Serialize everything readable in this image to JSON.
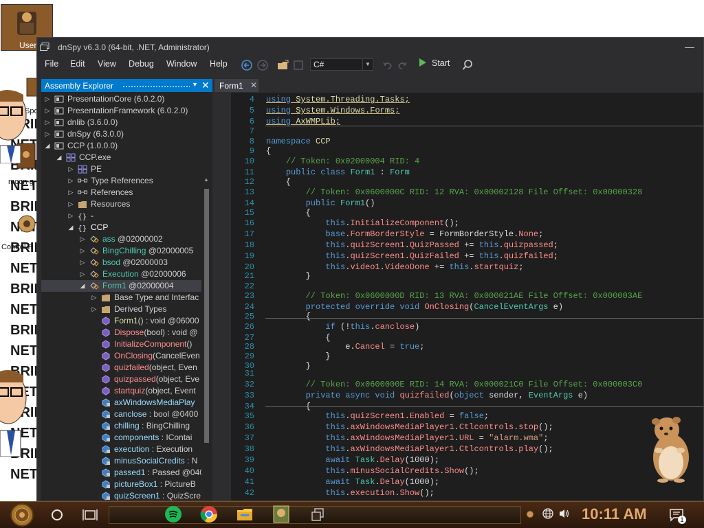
{
  "desktop": {
    "icons": [
      {
        "label": "User"
      },
      {
        "label": "Spo"
      },
      {
        "label": "moon g"
      },
      {
        "label": "Control P"
      }
    ],
    "wallpaper_words": [
      "BRII",
      "NET",
      "BRII",
      "NET",
      "BRII",
      "NET",
      "BRII",
      "NET",
      "BRII",
      "NET",
      "BRII",
      "NET",
      "BRII",
      "NET",
      "BRII",
      "NET",
      "BRII",
      "NET"
    ]
  },
  "window": {
    "title": "dnSpy v6.3.0 (64-bit, .NET, Administrator)",
    "menu": [
      "File",
      "Edit",
      "View",
      "Debug",
      "Window",
      "Help"
    ],
    "toolbar": {
      "language": "C#",
      "start_label": "Start"
    }
  },
  "explorer": {
    "title": "Assembly Explorer",
    "rows": [
      {
        "text": "PresentationCore (6.0.2.0)"
      },
      {
        "text": "PresentationFramework (6.0.2.0)"
      },
      {
        "text": "dnlib (3.6.0.0)"
      },
      {
        "text": "dnSpy (6.3.0.0)"
      },
      {
        "text": "CCP (1.0.0.0)"
      },
      {
        "text": "CCP.exe"
      },
      {
        "text": "PE"
      },
      {
        "text": "Type References"
      },
      {
        "text": "References"
      },
      {
        "text": "Resources"
      },
      {
        "text": "-"
      },
      {
        "text": "CCP"
      },
      {
        "name": "ass",
        "rest": " @02000002"
      },
      {
        "name": "BingChilling",
        "rest": " @02000005"
      },
      {
        "name": "bsod",
        "rest": " @02000003"
      },
      {
        "name": "Execution",
        "rest": " @02000006"
      },
      {
        "name": "Form1",
        "rest": " @02000004"
      },
      {
        "text": "Base Type and Interfac"
      },
      {
        "text": "Derived Types"
      },
      {
        "name": "Form1",
        "rest": "() : void @06000"
      },
      {
        "name": "Dispose",
        "rest": "(bool) : void @"
      },
      {
        "name": "InitializeComponent",
        "rest": "()"
      },
      {
        "name": "OnClosing",
        "rest": "(CancelEven"
      },
      {
        "name": "quizfailed",
        "rest": "(object, Even"
      },
      {
        "name": "quizpassed",
        "rest": "(object, Eve"
      },
      {
        "name": "startquiz",
        "rest": "(object, Event"
      },
      {
        "name": "axWindowsMediaPlay",
        "rest": ""
      },
      {
        "name": "canclose",
        "rest": " : bool @0400"
      },
      {
        "name": "chilling",
        "rest": " : BingChilling"
      },
      {
        "name": "components",
        "rest": " : IContai"
      },
      {
        "name": "execution",
        "rest": " : Execution"
      },
      {
        "name": "minusSocialCredits",
        "rest": " : N"
      },
      {
        "name": "passed1",
        "rest": " : Passed @040"
      },
      {
        "name": "pictureBox1",
        "rest": " : PictureB"
      },
      {
        "name": "quizScreen1",
        "rest": " : QuizScre"
      }
    ]
  },
  "editor": {
    "tab": "Form1",
    "lines": [
      {
        "n": "4",
        "seg": [
          [
            "k",
            "using "
          ],
          [
            "ns",
            "System.Threading.Tasks"
          ],
          [
            "p",
            ";"
          ]
        ]
      },
      {
        "n": "5",
        "seg": [
          [
            "k",
            "using "
          ],
          [
            "ns",
            "System.Windows.Forms"
          ],
          [
            "p",
            ";"
          ]
        ]
      },
      {
        "n": "6",
        "seg": [
          [
            "k",
            "using "
          ],
          [
            "ns",
            "AxWMPLib"
          ],
          [
            "p",
            ";"
          ]
        ]
      },
      {
        "n": "7",
        "seg": []
      },
      {
        "n": "8",
        "seg": [
          [
            "k",
            "namespace "
          ],
          [
            "ns",
            "CCP"
          ]
        ]
      },
      {
        "n": "9",
        "seg": [
          [
            "p",
            "{"
          ]
        ]
      },
      {
        "n": "10",
        "seg": [
          [
            "p",
            "    "
          ],
          [
            "cm",
            "// Token: 0x02000004 RID: 4"
          ]
        ]
      },
      {
        "n": "11",
        "seg": [
          [
            "p",
            "    "
          ],
          [
            "k",
            "public class "
          ],
          [
            "ty",
            "Form1"
          ],
          [
            "p",
            " : "
          ],
          [
            "ty",
            "Form"
          ]
        ]
      },
      {
        "n": "12",
        "seg": [
          [
            "p",
            "    {"
          ]
        ]
      },
      {
        "n": "13",
        "seg": [
          [
            "p",
            "        "
          ],
          [
            "cm",
            "// Token: 0x0600000C RID: 12 RVA: 0x00002128 File Offset: 0x00000328"
          ]
        ]
      },
      {
        "n": "14",
        "seg": [
          [
            "p",
            "        "
          ],
          [
            "k",
            "public "
          ],
          [
            "ty",
            "Form1"
          ],
          [
            "p",
            "()"
          ]
        ]
      },
      {
        "n": "15",
        "seg": [
          [
            "p",
            "        {"
          ]
        ]
      },
      {
        "n": "16",
        "seg": [
          [
            "p",
            "            "
          ],
          [
            "k",
            "this"
          ],
          [
            "p",
            "."
          ],
          [
            "mt",
            "InitializeComponent"
          ],
          [
            "p",
            "();"
          ]
        ]
      },
      {
        "n": "17",
        "seg": [
          [
            "p",
            "            "
          ],
          [
            "k",
            "base"
          ],
          [
            "p",
            "."
          ],
          [
            "fd",
            "FormBorderStyle"
          ],
          [
            "p",
            " = FormBorderStyle."
          ],
          [
            "fd",
            "None"
          ],
          [
            "p",
            ";"
          ]
        ]
      },
      {
        "n": "18",
        "seg": [
          [
            "p",
            "            "
          ],
          [
            "k",
            "this"
          ],
          [
            "p",
            "."
          ],
          [
            "fd",
            "quizScreen1"
          ],
          [
            "p",
            "."
          ],
          [
            "fd",
            "QuizPassed"
          ],
          [
            "p",
            " += "
          ],
          [
            "k",
            "this"
          ],
          [
            "p",
            "."
          ],
          [
            "mt",
            "quizpassed"
          ],
          [
            "p",
            ";"
          ]
        ]
      },
      {
        "n": "19",
        "seg": [
          [
            "p",
            "            "
          ],
          [
            "k",
            "this"
          ],
          [
            "p",
            "."
          ],
          [
            "fd",
            "quizScreen1"
          ],
          [
            "p",
            "."
          ],
          [
            "fd",
            "QuizFailed"
          ],
          [
            "p",
            " += "
          ],
          [
            "k",
            "this"
          ],
          [
            "p",
            "."
          ],
          [
            "mt",
            "quizfailed"
          ],
          [
            "p",
            ";"
          ]
        ]
      },
      {
        "n": "20",
        "seg": [
          [
            "p",
            "            "
          ],
          [
            "k",
            "this"
          ],
          [
            "p",
            "."
          ],
          [
            "fd",
            "video1"
          ],
          [
            "p",
            "."
          ],
          [
            "fd",
            "VideoDone"
          ],
          [
            "p",
            " += "
          ],
          [
            "k",
            "this"
          ],
          [
            "p",
            "."
          ],
          [
            "mt",
            "startquiz"
          ],
          [
            "p",
            ";"
          ]
        ]
      },
      {
        "n": "21",
        "seg": [
          [
            "p",
            "        }"
          ]
        ]
      },
      {
        "n": "22",
        "seg": []
      },
      {
        "n": "23",
        "seg": [
          [
            "p",
            "        "
          ],
          [
            "cm",
            "// Token: 0x0600000D RID: 13 RVA: 0x000021AE File Offset: 0x000003AE"
          ]
        ]
      },
      {
        "n": "24",
        "seg": [
          [
            "p",
            "        "
          ],
          [
            "k",
            "protected override void "
          ],
          [
            "mt",
            "OnClosing"
          ],
          [
            "p",
            "("
          ],
          [
            "ty",
            "CancelEventArgs"
          ],
          [
            "p",
            " e)"
          ]
        ]
      },
      {
        "n": "25",
        "seg": [
          [
            "p",
            "        {"
          ]
        ]
      },
      {
        "n": "26",
        "seg": [
          [
            "p",
            "            "
          ],
          [
            "k",
            "if "
          ],
          [
            "p",
            "(!"
          ],
          [
            "k",
            "this"
          ],
          [
            "p",
            "."
          ],
          [
            "fd",
            "canclose"
          ],
          [
            "p",
            ")"
          ]
        ]
      },
      {
        "n": "27",
        "seg": [
          [
            "p",
            "            {"
          ]
        ]
      },
      {
        "n": "28",
        "seg": [
          [
            "p",
            "                e."
          ],
          [
            "fd",
            "Cancel"
          ],
          [
            "p",
            " = "
          ],
          [
            "k",
            "true"
          ],
          [
            "p",
            ";"
          ]
        ]
      },
      {
        "n": "29",
        "seg": [
          [
            "p",
            "            }"
          ]
        ]
      },
      {
        "n": "30",
        "seg": [
          [
            "p",
            "        }"
          ]
        ]
      },
      {
        "n": "31",
        "seg": []
      },
      {
        "n": "32",
        "seg": [
          [
            "p",
            "        "
          ],
          [
            "cm",
            "// Token: 0x0600000E RID: 14 RVA: 0x000021C0 File Offset: 0x000003C0"
          ]
        ]
      },
      {
        "n": "33",
        "seg": [
          [
            "p",
            "        "
          ],
          [
            "k",
            "private async void "
          ],
          [
            "mt",
            "quizfailed"
          ],
          [
            "p",
            "("
          ],
          [
            "k",
            "object"
          ],
          [
            "p",
            " sender, "
          ],
          [
            "ty",
            "EventArgs"
          ],
          [
            "p",
            " e)"
          ]
        ]
      },
      {
        "n": "34",
        "seg": [
          [
            "p",
            "        {"
          ]
        ]
      },
      {
        "n": "35",
        "seg": [
          [
            "p",
            "            "
          ],
          [
            "k",
            "this"
          ],
          [
            "p",
            "."
          ],
          [
            "fd",
            "quizScreen1"
          ],
          [
            "p",
            "."
          ],
          [
            "fd",
            "Enabled"
          ],
          [
            "p",
            " = "
          ],
          [
            "k",
            "false"
          ],
          [
            "p",
            ";"
          ]
        ]
      },
      {
        "n": "36",
        "seg": [
          [
            "p",
            "            "
          ],
          [
            "k",
            "this"
          ],
          [
            "p",
            "."
          ],
          [
            "fd",
            "axWindowsMediaPlayer1"
          ],
          [
            "p",
            "."
          ],
          [
            "fd",
            "Ctlcontrols"
          ],
          [
            "p",
            "."
          ],
          [
            "mt",
            "stop"
          ],
          [
            "p",
            "();"
          ]
        ]
      },
      {
        "n": "37",
        "seg": [
          [
            "p",
            "            "
          ],
          [
            "k",
            "this"
          ],
          [
            "p",
            "."
          ],
          [
            "fd",
            "axWindowsMediaPlayer1"
          ],
          [
            "p",
            "."
          ],
          [
            "fd",
            "URL"
          ],
          [
            "p",
            " = "
          ],
          [
            "st",
            "\"alarm.wma\""
          ],
          [
            "p",
            ";"
          ]
        ]
      },
      {
        "n": "38",
        "seg": [
          [
            "p",
            "            "
          ],
          [
            "k",
            "this"
          ],
          [
            "p",
            "."
          ],
          [
            "fd",
            "axWindowsMediaPlayer1"
          ],
          [
            "p",
            "."
          ],
          [
            "fd",
            "Ctlcontrols"
          ],
          [
            "p",
            "."
          ],
          [
            "mt",
            "play"
          ],
          [
            "p",
            "();"
          ]
        ]
      },
      {
        "n": "39",
        "seg": [
          [
            "p",
            "            "
          ],
          [
            "k",
            "await "
          ],
          [
            "ty",
            "Task"
          ],
          [
            "p",
            "."
          ],
          [
            "mt",
            "Delay"
          ],
          [
            "p",
            "(1000);"
          ]
        ]
      },
      {
        "n": "40",
        "seg": [
          [
            "p",
            "            "
          ],
          [
            "k",
            "this"
          ],
          [
            "p",
            "."
          ],
          [
            "fd",
            "minusSocialCredits"
          ],
          [
            "p",
            "."
          ],
          [
            "mt",
            "Show"
          ],
          [
            "p",
            "();"
          ]
        ]
      },
      {
        "n": "41",
        "seg": [
          [
            "p",
            "            "
          ],
          [
            "k",
            "await "
          ],
          [
            "ty",
            "Task"
          ],
          [
            "p",
            "."
          ],
          [
            "mt",
            "Delay"
          ],
          [
            "p",
            "(1000);"
          ]
        ]
      },
      {
        "n": "42",
        "seg": [
          [
            "p",
            "            "
          ],
          [
            "k",
            "this"
          ],
          [
            "p",
            "."
          ],
          [
            "fd",
            "execution"
          ],
          [
            "p",
            "."
          ],
          [
            "mt",
            "Show"
          ],
          [
            "p",
            "();"
          ]
        ]
      }
    ]
  },
  "taskbar": {
    "clock": "10:11 AM",
    "notification_count": "1"
  }
}
